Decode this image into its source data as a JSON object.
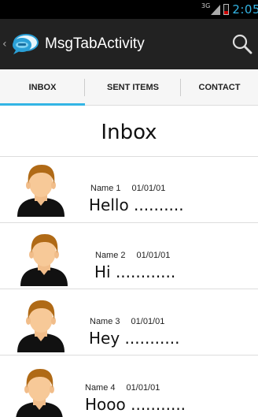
{
  "status_bar": {
    "network": "3G",
    "time": "2:05"
  },
  "action_bar": {
    "title": "MsgTabActivity",
    "app_icon": "chat-bubbles-icon",
    "search_icon": "search-icon"
  },
  "tabs": [
    {
      "label": "INBOX",
      "selected": true
    },
    {
      "label": "SENT ITEMS",
      "selected": false
    },
    {
      "label": "CONTACT",
      "selected": false
    }
  ],
  "colors": {
    "accent": "#33b5e5",
    "action_bar": "#222222",
    "status_bar": "#000000",
    "battery_low": "#cc0000"
  },
  "page": {
    "title": "Inbox"
  },
  "messages": [
    {
      "name": "Name 1",
      "date": "01/01/01",
      "text": "Hello .........."
    },
    {
      "name": "Name 2",
      "date": "01/01/01",
      "text": "Hi ............"
    },
    {
      "name": "Name 3",
      "date": "01/01/01",
      "text": "Hey ..........."
    },
    {
      "name": "Name 4",
      "date": "01/01/01",
      "text": "Hooo ..........."
    }
  ]
}
